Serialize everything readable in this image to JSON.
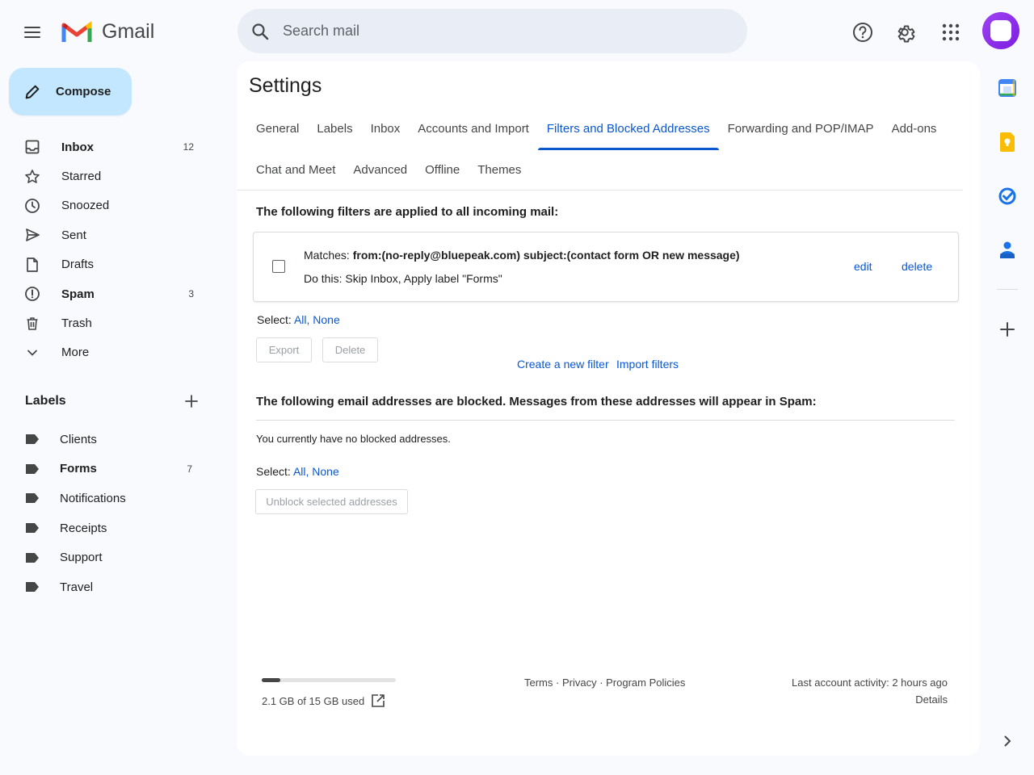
{
  "app": {
    "name": "Gmail",
    "search_placeholder": "Search mail"
  },
  "compose_label": "Compose",
  "nav": [
    {
      "label": "Inbox",
      "count": "12",
      "icon": "inbox-icon",
      "bold": true
    },
    {
      "label": "Starred",
      "count": "",
      "icon": "star-icon",
      "bold": false
    },
    {
      "label": "Snoozed",
      "count": "",
      "icon": "clock-icon",
      "bold": false
    },
    {
      "label": "Sent",
      "count": "",
      "icon": "send-icon",
      "bold": false
    },
    {
      "label": "Drafts",
      "count": "",
      "icon": "draft-icon",
      "bold": false
    },
    {
      "label": "Spam",
      "count": "3",
      "icon": "spam-icon",
      "bold": true
    },
    {
      "label": "Trash",
      "count": "",
      "icon": "trash-icon",
      "bold": false
    },
    {
      "label": "More",
      "count": "",
      "icon": "chevron-down-icon",
      "bold": false
    }
  ],
  "labels_heading": "Labels",
  "labels": [
    {
      "label": "Clients",
      "count": "",
      "bold": false
    },
    {
      "label": "Forms",
      "count": "7",
      "bold": true
    },
    {
      "label": "Notifications",
      "count": "",
      "bold": false
    },
    {
      "label": "Receipts",
      "count": "",
      "bold": false
    },
    {
      "label": "Support",
      "count": "",
      "bold": false
    },
    {
      "label": "Travel",
      "count": "",
      "bold": false
    }
  ],
  "settings": {
    "title": "Settings",
    "tabs_row1": [
      "General",
      "Labels",
      "Inbox",
      "Accounts and Import",
      "Filters and Blocked Addresses",
      "Forwarding and POP/IMAP",
      "Add-ons"
    ],
    "tabs_row2": [
      "Chat and Meet",
      "Advanced",
      "Offline",
      "Themes"
    ],
    "active_tab": "Filters and Blocked Addresses",
    "filters_heading": "The following filters are applied to all incoming mail:",
    "filter": {
      "matches_label": "Matches:",
      "matches_value": "from:(no-reply@bluepeak.com) subject:(contact form OR new message)",
      "do_this_label": "Do this:",
      "do_this_value": "Skip Inbox, Apply label \"Forms\"",
      "edit": "edit",
      "delete": "delete"
    },
    "select_label": "Select:",
    "select_all": "All",
    "select_none": "None",
    "export_button": "Export",
    "delete_button": "Delete",
    "create_filter": "Create a new filter",
    "import_filters": "Import filters",
    "blocked_heading": "The following email addresses are blocked. Messages from these addresses will appear in Spam:",
    "blocked_empty": "You currently have no blocked addresses.",
    "unblock_button": "Unblock selected addresses"
  },
  "footer": {
    "storage_text": "2.1 GB of 15 GB used",
    "storage_used_fraction": 0.14,
    "terms": "Terms",
    "privacy": "Privacy",
    "program_policies": "Program Policies",
    "last_activity": "Last account activity: 2 hours ago",
    "details": "Details"
  },
  "colors": {
    "accent": "#0b57d0",
    "compose_bg": "#c2e7ff",
    "search_bg": "#e9eef6",
    "avatar": "#9334e6"
  }
}
